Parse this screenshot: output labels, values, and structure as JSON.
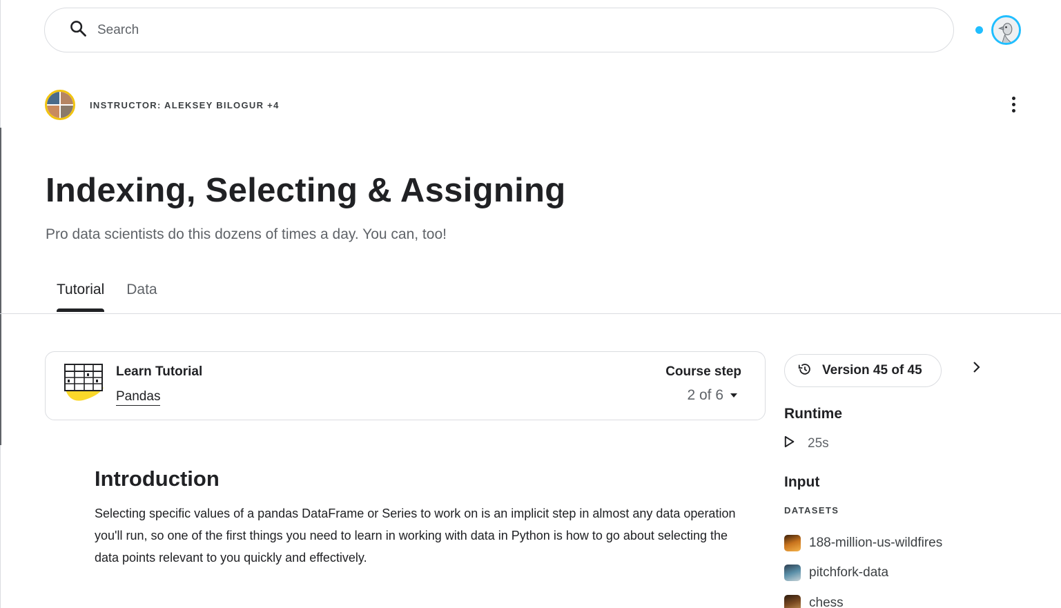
{
  "search": {
    "placeholder": "Search"
  },
  "colors": {
    "accent": "#20beff",
    "instructor_ring": "#f1c40f",
    "learn_blob": "#fbd82a"
  },
  "header": {
    "instructor": "INSTRUCTOR: ALEKSEY BILOGUR +4",
    "title": "Indexing, Selecting & Assigning",
    "subtitle": "Pro data scientists do this dozens of times a day. You can, too!"
  },
  "tabs": [
    {
      "label": "Tutorial",
      "active": true
    },
    {
      "label": "Data",
      "active": false
    }
  ],
  "learn_card": {
    "label": "Learn Tutorial",
    "course": "Pandas",
    "course_step_label": "Course step",
    "course_step_value": "2 of 6"
  },
  "content": {
    "heading": "Introduction",
    "body": "Selecting specific values of a pandas DataFrame or Series to work on is an implicit step in almost any data operation you'll run, so one of the first things you need to learn in working with data in Python is how to go about selecting the data points relevant to you quickly and effectively."
  },
  "sidebar": {
    "version": "Version 45 of 45",
    "runtime_heading": "Runtime",
    "runtime_value": "25s",
    "input_heading": "Input",
    "datasets_label": "DATASETS",
    "datasets": [
      {
        "name": "188-million-us-wildfires",
        "thumb_colors": [
          "#3a1f0a",
          "#c9741e",
          "#f4b24a"
        ]
      },
      {
        "name": "pitchfork-data",
        "thumb_colors": [
          "#2c3e50",
          "#5a8fa8",
          "#c7d3d8"
        ]
      },
      {
        "name": "chess",
        "thumb_colors": [
          "#2b1a0e",
          "#7a4a22",
          "#c99a5b"
        ]
      }
    ]
  },
  "icons": {
    "search": "search-icon",
    "avatar": "user-avatar",
    "more": "more-vert-icon",
    "history": "history-icon",
    "next": "chevron-right-icon",
    "play": "play-icon",
    "learn": "table-grid-icon"
  }
}
